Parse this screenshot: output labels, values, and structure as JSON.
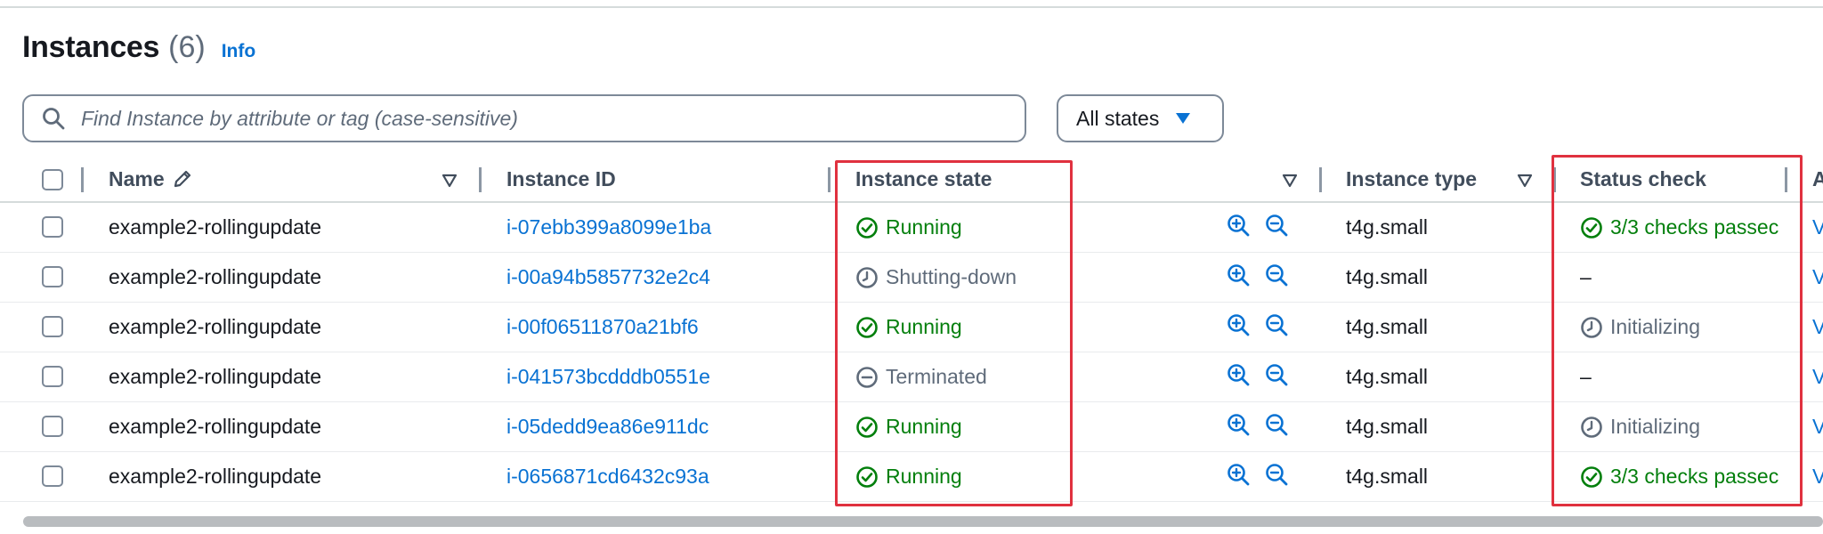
{
  "header": {
    "title": "Instances",
    "count": "(6)",
    "info_link": "Info"
  },
  "search": {
    "placeholder": "Find Instance by attribute or tag (case-sensitive)",
    "value": ""
  },
  "state_filter": {
    "selected": "All states"
  },
  "columns": {
    "name": "Name",
    "instance_id": "Instance ID",
    "instance_state": "Instance state",
    "instance_type": "Instance type",
    "status_check": "Status check",
    "next_partial": "A"
  },
  "rows": [
    {
      "name": "example2-rollingupdate",
      "instance_id": "i-07ebb399a8099e1ba",
      "state": "Running",
      "state_icon": "check-circle-icon",
      "type": "t4g.small",
      "status": "3/3 checks passec",
      "status_icon": "check-circle-icon",
      "next_partial": "V"
    },
    {
      "name": "example2-rollingupdate",
      "instance_id": "i-00a94b5857732e2c4",
      "state": "Shutting-down",
      "state_icon": "clock-icon",
      "type": "t4g.small",
      "status": "–",
      "status_icon": "",
      "next_partial": "V"
    },
    {
      "name": "example2-rollingupdate",
      "instance_id": "i-00f06511870a21bf6",
      "state": "Running",
      "state_icon": "check-circle-icon",
      "type": "t4g.small",
      "status": "Initializing",
      "status_icon": "clock-icon",
      "next_partial": "V"
    },
    {
      "name": "example2-rollingupdate",
      "instance_id": "i-041573bcdddb0551e",
      "state": "Terminated",
      "state_icon": "minus-circle-icon",
      "type": "t4g.small",
      "status": "–",
      "status_icon": "",
      "next_partial": "V"
    },
    {
      "name": "example2-rollingupdate",
      "instance_id": "i-05dedd9ea86e911dc",
      "state": "Running",
      "state_icon": "check-circle-icon",
      "type": "t4g.small",
      "status": "Initializing",
      "status_icon": "clock-icon",
      "next_partial": "V"
    },
    {
      "name": "example2-rollingupdate",
      "instance_id": "i-0656871cd6432c93a",
      "state": "Running",
      "state_icon": "check-circle-icon",
      "type": "t4g.small",
      "status": "3/3 checks passec",
      "status_icon": "check-circle-icon",
      "next_partial": "V"
    }
  ],
  "colors": {
    "link": "#0972d3",
    "success": "#037f0c",
    "muted": "#5f6b7a",
    "highlight": "#e0313f"
  }
}
